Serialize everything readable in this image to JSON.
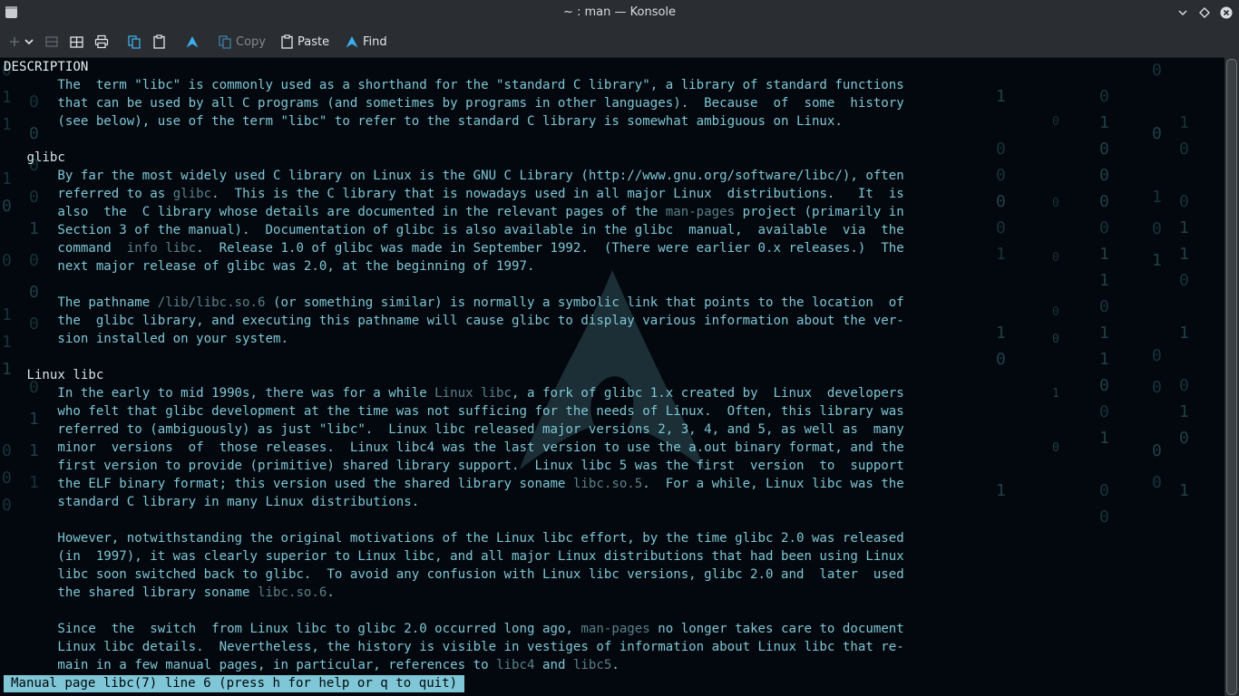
{
  "window": {
    "title": "~ : man — Konsole"
  },
  "toolbar": {
    "copy_label": "Copy",
    "paste_label": "Paste",
    "find_label": "Find"
  },
  "colors": {
    "accent": "#7fc6d6",
    "background": "#02080d",
    "chrome": "#2a2e32"
  },
  "man": {
    "lines": [
      [
        {
          "t": "DESCRIPTION"
        }
      ],
      [
        {
          "t": "       The  term \"libc\" is commonly used as a shorthand for the \"standard C library\", a library of standard functions"
        }
      ],
      [
        {
          "t": "       that can be used by all C programs (and sometimes by programs in other languages).  Because  of  some  history"
        }
      ],
      [
        {
          "t": "       (see below), use of the term \"libc\" to refer to the standard C library is somewhat ambiguous on Linux."
        }
      ],
      [],
      [
        {
          "t": "   glibc",
          "s": "sub"
        }
      ],
      [
        {
          "t": "       By far the most widely used C library on Linux is the GNU C Library (http://www.gnu.org/software/libc/), often"
        }
      ],
      [
        {
          "t": "       referred to as "
        },
        {
          "t": "glibc",
          "s": "dim"
        },
        {
          "t": ".  This is the C library that is nowadays used in all major Linux  distributions.   It  is"
        }
      ],
      [
        {
          "t": "       also  the  C library whose details are documented in the relevant pages of the "
        },
        {
          "t": "man-pages",
          "s": "dim"
        },
        {
          "t": " project (primarily in"
        }
      ],
      [
        {
          "t": "       Section 3 of the manual).  Documentation of glibc is also available in the glibc  manual,  available  via  the"
        }
      ],
      [
        {
          "t": "       command  "
        },
        {
          "t": "info libc",
          "s": "dim"
        },
        {
          "t": ".  Release 1.0 of glibc was made in September 1992.  (There were earlier 0.x releases.)  The"
        }
      ],
      [
        {
          "t": "       next major release of glibc was 2.0, at the beginning of 1997."
        }
      ],
      [],
      [
        {
          "t": "       The pathname "
        },
        {
          "t": "/lib/libc.so.6",
          "s": "dim"
        },
        {
          "t": " (or something similar) is normally a symbolic link that points to the location  of"
        }
      ],
      [
        {
          "t": "       the  glibc library, and executing this pathname will cause glibc to display various information about the ver-"
        }
      ],
      [
        {
          "t": "       sion installed on your system."
        }
      ],
      [],
      [
        {
          "t": "   Linux libc",
          "s": "sub"
        }
      ],
      [
        {
          "t": "       In the early to mid 1990s, there was for a while "
        },
        {
          "t": "Linux libc",
          "s": "dim"
        },
        {
          "t": ", a fork of glibc 1.x created by  Linux  developers"
        }
      ],
      [
        {
          "t": "       who felt that glibc development at the time was not sufficing for the needs of Linux.  Often, this library was"
        }
      ],
      [
        {
          "t": "       referred to (ambiguously) as just \"libc\".  Linux libc released major versions 2, 3, 4, and 5, as well as  many"
        }
      ],
      [
        {
          "t": "       minor  versions  of  those releases.  Linux libc4 was the last version to use the a.out binary format, and the"
        }
      ],
      [
        {
          "t": "       first version to provide (primitive) shared library support.  Linux libc 5 was the first  version  to  support"
        }
      ],
      [
        {
          "t": "       the ELF binary format; this version used the shared library soname "
        },
        {
          "t": "libc.so.5",
          "s": "dim"
        },
        {
          "t": ".  For a while, Linux libc was the"
        }
      ],
      [
        {
          "t": "       standard C library in many Linux distributions."
        }
      ],
      [],
      [
        {
          "t": "       However, notwithstanding the original motivations of the Linux libc effort, by the time glibc 2.0 was released"
        }
      ],
      [
        {
          "t": "       (in  1997), it was clearly superior to Linux libc, and all major Linux distributions that had been using Linux"
        }
      ],
      [
        {
          "t": "       libc soon switched back to glibc.  To avoid any confusion with Linux libc versions, glibc 2.0 and  later  used"
        }
      ],
      [
        {
          "t": "       the shared library soname "
        },
        {
          "t": "libc.so.6",
          "s": "dim"
        },
        {
          "t": "."
        }
      ],
      [],
      [
        {
          "t": "       Since  the  switch  from Linux libc to glibc 2.0 occurred long ago, "
        },
        {
          "t": "man-pages",
          "s": "dim"
        },
        {
          "t": " no longer takes care to document"
        }
      ],
      [
        {
          "t": "       Linux libc details.  Nevertheless, the history is visible in vestiges of information about Linux libc that re-"
        }
      ],
      [
        {
          "t": "       main in a few manual pages, in particular, references to "
        },
        {
          "t": "libc4",
          "s": "dim"
        },
        {
          "t": " and "
        },
        {
          "t": "libc5",
          "s": "dim"
        },
        {
          "t": "."
        }
      ]
    ],
    "status": "Manual page libc(7) line 6 (press h for help or q to quit)"
  }
}
